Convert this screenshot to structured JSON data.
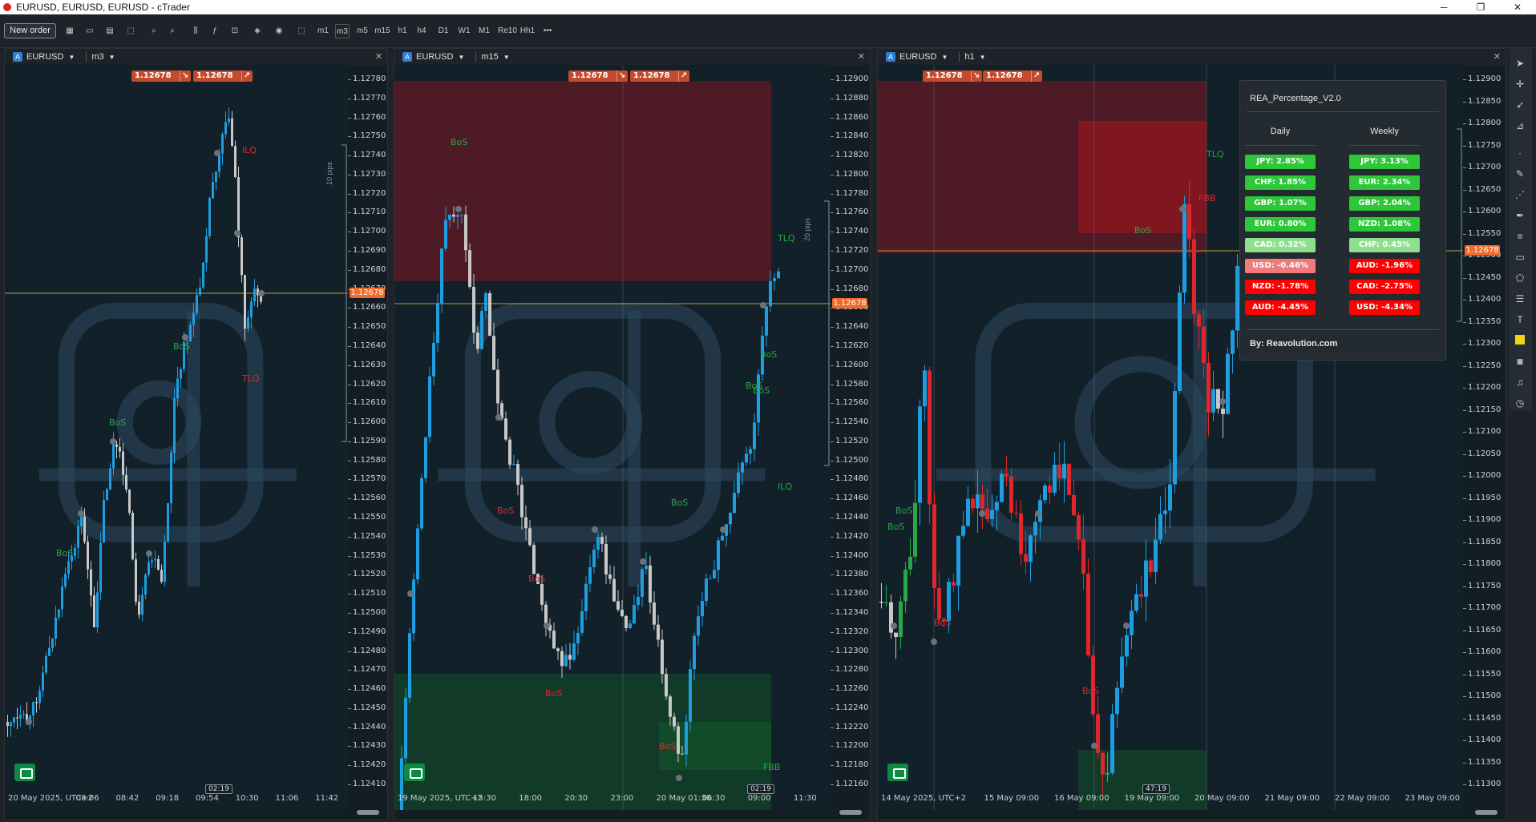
{
  "window": {
    "title": "EURUSD, EURUSD, EURUSD - cTrader",
    "controls": [
      "─",
      "❐",
      "✕"
    ]
  },
  "toolbar": {
    "new_order": "New order",
    "timeframes": [
      "m1",
      "m3",
      "m5",
      "m15",
      "h1",
      "h4",
      "D1",
      "W1",
      "M1",
      "Re10",
      "Hh1"
    ],
    "more": "•••"
  },
  "colors": {
    "bull": "#1e9de0",
    "bear": "#c8c8c8",
    "bear_red": "#e0262a",
    "bull_green": "#28a745",
    "price_tag": "#f06a2a",
    "quote_button": "#c54a2c"
  },
  "panels": [
    {
      "symbol": "EURUSD",
      "timeframe": "m3",
      "close": "✕",
      "quote_bid": "1.12678",
      "quote_ask": "1.12678",
      "price_axis": [
        "1.12780",
        "1.12770",
        "1.12760",
        "1.12750",
        "1.12740",
        "1.12730",
        "1.12720",
        "1.12710",
        "1.12700",
        "1.12690",
        "1.12680",
        "1.12670",
        "1.12660",
        "1.12650",
        "1.12640",
        "1.12630",
        "1.12620",
        "1.12610",
        "1.12600",
        "1.12590",
        "1.12580",
        "1.12570",
        "1.12560",
        "1.12550",
        "1.12540",
        "1.12530",
        "1.12520",
        "1.12510",
        "1.12500",
        "1.12490",
        "1.12480",
        "1.12470",
        "1.12460",
        "1.12450",
        "1.12440",
        "1.12430",
        "1.12420",
        "1.12410"
      ],
      "current_price": "1.12678",
      "time_axis": [
        "20 May 2025, UTC+2",
        "08:06",
        "08:42",
        "09:18",
        "09:54",
        "10:30",
        "11:06",
        "11:42"
      ],
      "time_marker": "02:19",
      "range_label": "10 pips",
      "labels": [
        {
          "text": "ILQ",
          "c": "red"
        },
        {
          "text": "TLQ",
          "c": "red"
        },
        {
          "text": "BoS",
          "c": "grn"
        },
        {
          "text": "BoS",
          "c": "grn"
        },
        {
          "text": "BoS",
          "c": "grn"
        }
      ]
    },
    {
      "symbol": "EURUSD",
      "timeframe": "m15",
      "close": "✕",
      "quote_bid": "1.12678",
      "quote_ask": "1.12678",
      "price_axis": [
        "1.12900",
        "1.12880",
        "1.12860",
        "1.12840",
        "1.12820",
        "1.12800",
        "1.12780",
        "1.12760",
        "1.12740",
        "1.12720",
        "1.12700",
        "1.12680",
        "1.12660",
        "1.12640",
        "1.12620",
        "1.12600",
        "1.12580",
        "1.12560",
        "1.12540",
        "1.12520",
        "1.12500",
        "1.12480",
        "1.12460",
        "1.12440",
        "1.12420",
        "1.12400",
        "1.12380",
        "1.12360",
        "1.12340",
        "1.12320",
        "1.12300",
        "1.12280",
        "1.12260",
        "1.12240",
        "1.12220",
        "1.12200",
        "1.12180",
        "1.12160"
      ],
      "current_price": "1.12678",
      "time_axis": [
        "19 May 2025, UTC+2",
        "15:30",
        "18:00",
        "20:30",
        "23:00",
        "20 May 01:30",
        "06:30",
        "09:00",
        "11:30"
      ],
      "time_marker": "02:19",
      "range_label": "20 pips",
      "labels": [
        {
          "text": "BoS",
          "c": "grn"
        },
        {
          "text": "TLQ",
          "c": "grn"
        },
        {
          "text": "BoS",
          "c": "grn"
        },
        {
          "text": "BoS",
          "c": "grn"
        },
        {
          "text": "BoS",
          "c": "grn"
        },
        {
          "text": "ILQ",
          "c": "grn"
        },
        {
          "text": "BoS",
          "c": "grn"
        },
        {
          "text": "BoS",
          "c": "red"
        },
        {
          "text": "BoS",
          "c": "red"
        },
        {
          "text": "BoS",
          "c": "red"
        },
        {
          "text": "BoS",
          "c": "red"
        },
        {
          "text": "FBB",
          "c": "grn"
        }
      ]
    },
    {
      "symbol": "EURUSD",
      "timeframe": "h1",
      "close": "✕",
      "quote_bid": "1.12678",
      "quote_ask": "1.12678",
      "price_axis": [
        "1.12900",
        "1.12850",
        "1.12800",
        "1.12750",
        "1.12700",
        "1.12650",
        "1.12600",
        "1.12550",
        "1.12500",
        "1.12450",
        "1.12400",
        "1.12350",
        "1.12300",
        "1.12250",
        "1.12200",
        "1.12150",
        "1.12100",
        "1.12050",
        "1.12000",
        "1.11950",
        "1.11900",
        "1.11850",
        "1.11800",
        "1.11750",
        "1.11700",
        "1.11650",
        "1.11600",
        "1.11550",
        "1.11500",
        "1.11450",
        "1.11400",
        "1.11350",
        "1.11300"
      ],
      "current_price": "1.12678",
      "time_axis": [
        "14 May 2025, UTC+2",
        "15 May 09:00",
        "16 May 09:00",
        "19 May 09:00",
        "20 May 09:00",
        "21 May 09:00",
        "22 May 09:00",
        "23 May 09:00"
      ],
      "time_marker": "47:19",
      "range_label": "25 pips",
      "labels": [
        {
          "text": "TLQ",
          "c": "grn"
        },
        {
          "text": "FBB",
          "c": "red"
        },
        {
          "text": "BoS",
          "c": "grn"
        },
        {
          "text": "BoS",
          "c": "grn"
        },
        {
          "text": "BoS",
          "c": "grn"
        },
        {
          "text": "BoS",
          "c": "red"
        },
        {
          "text": "BoS",
          "c": "red"
        }
      ]
    }
  ],
  "rea_panel": {
    "title": "REA_Percentage_V2.0",
    "daily_header": "Daily",
    "weekly_header": "Weekly",
    "daily": [
      {
        "text": "JPY: 2.85%",
        "bg": "#2ec73a"
      },
      {
        "text": "CHF: 1.85%",
        "bg": "#2ec73a"
      },
      {
        "text": "GBP: 1.07%",
        "bg": "#2ec73a"
      },
      {
        "text": "EUR: 0.80%",
        "bg": "#2ec73a"
      },
      {
        "text": "CAD: 0.32%",
        "bg": "#8ee08e"
      },
      {
        "text": "USD: -0.46%",
        "bg": "#ef7b7b"
      },
      {
        "text": "NZD: -1.78%",
        "bg": "#ff0000"
      },
      {
        "text": "AUD: -4.45%",
        "bg": "#ff0000"
      }
    ],
    "weekly": [
      {
        "text": "JPY: 3.13%",
        "bg": "#2ec73a"
      },
      {
        "text": "EUR: 2.34%",
        "bg": "#2ec73a"
      },
      {
        "text": "GBP: 2.04%",
        "bg": "#2ec73a"
      },
      {
        "text": "NZD: 1.08%",
        "bg": "#2ec73a"
      },
      {
        "text": "CHF: 0.45%",
        "bg": "#8ee08e"
      },
      {
        "text": "AUD: -1.96%",
        "bg": "#ff0000"
      },
      {
        "text": "CAD: -2.75%",
        "bg": "#ff0000"
      },
      {
        "text": "USD: -4.34%",
        "bg": "#ff0000"
      }
    ],
    "footer": "By: Reavolution.com"
  }
}
